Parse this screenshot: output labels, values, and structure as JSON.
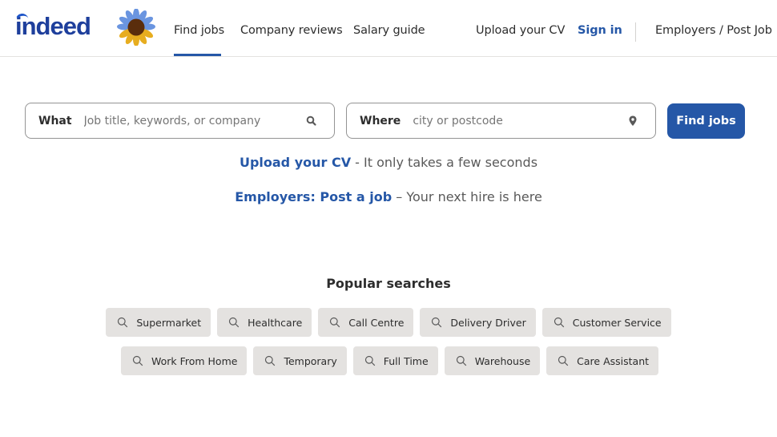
{
  "header": {
    "logo_text": "indeed",
    "nav": [
      {
        "label": "Find jobs",
        "active": true
      },
      {
        "label": "Company reviews",
        "active": false
      },
      {
        "label": "Salary guide",
        "active": false
      }
    ],
    "right": {
      "upload_cv": "Upload your CV",
      "sign_in": "Sign in",
      "employers": "Employers / Post Job"
    },
    "accent_color": "#2557a7"
  },
  "search": {
    "what_label": "What",
    "what_placeholder": "Job title, keywords, or company",
    "what_icon": "search-icon",
    "where_label": "Where",
    "where_placeholder": "city or postcode",
    "where_icon": "location-pin-icon",
    "button_label": "Find jobs"
  },
  "promos": [
    {
      "link": "Upload your CV",
      "text": " - It only takes a few seconds"
    },
    {
      "link": "Employers: Post a job",
      "text": " – Your next hire is here"
    }
  ],
  "popular": {
    "title": "Popular searches",
    "row1": [
      "Supermarket",
      "Healthcare",
      "Call Centre",
      "Delivery Driver",
      "Customer Service"
    ],
    "row2": [
      "Work From Home",
      "Temporary",
      "Full Time",
      "Warehouse",
      "Care Assistant"
    ]
  }
}
